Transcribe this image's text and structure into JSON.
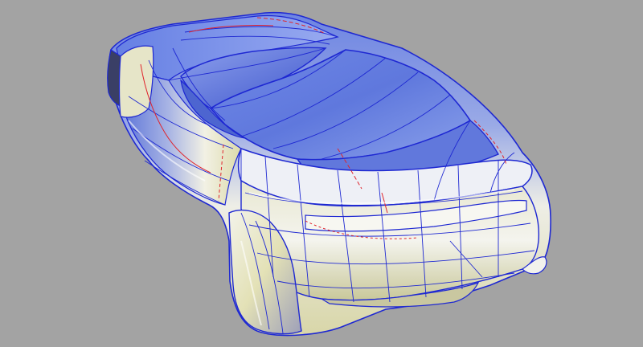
{
  "viewport": {
    "background_color": "#a3a3a3",
    "render_mode": "shaded-with-isoparms",
    "view": "perspective-rear-three-quarter"
  },
  "model": {
    "subject": "sports-car-body-surface-model",
    "colors": {
      "surface_highlight": "#f4f4f0",
      "surface_yellow": "#e6e5b8",
      "surface_blue": "#6a82e0",
      "surface_deep_blue": "#3f55c9",
      "isoparm_blue": "#1e28d2",
      "trim_curve_red": "#e0242c",
      "shadow_dark": "#3a3f66"
    }
  }
}
